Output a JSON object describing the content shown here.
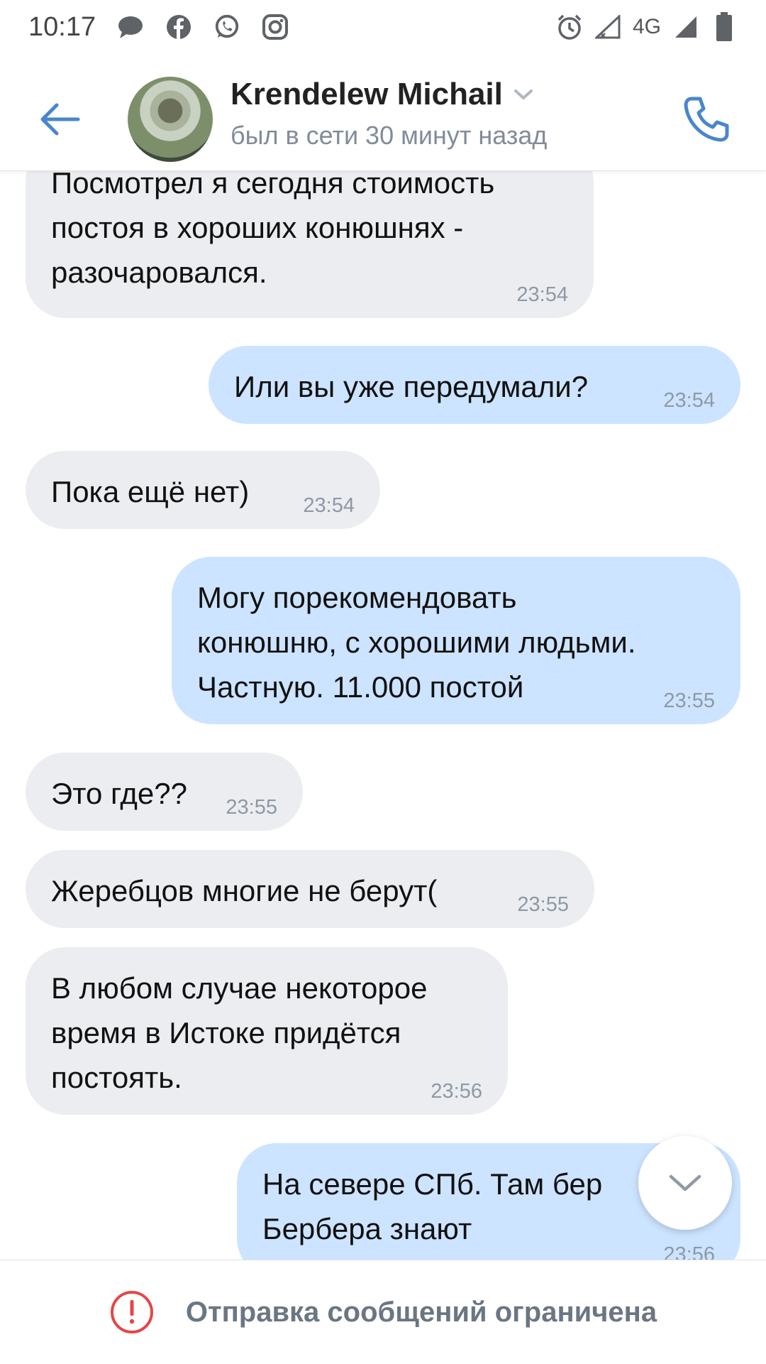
{
  "status_bar": {
    "time": "10:17",
    "network_label": "4G",
    "notification_icons": [
      "message-bubble-icon",
      "facebook-icon",
      "whatsapp-icon",
      "instagram-icon"
    ]
  },
  "header": {
    "contact_name": "Krendelew Michail",
    "contact_status": "был в сети 30 минут назад",
    "accent_color": "#4986cc"
  },
  "messages": [
    {
      "direction": "in",
      "text": "Посмотрел я сегодня стоимость\nпостоя в хороших конюшнях -\nразочаровался.",
      "time": "23:54"
    },
    {
      "direction": "out",
      "text": "Или вы уже передумали?",
      "time": "23:54"
    },
    {
      "direction": "in",
      "text": "Пока ещё нет)",
      "time": "23:54"
    },
    {
      "direction": "out",
      "text": "Могу порекомендовать\nконюшню, с хорошими людьми.\nЧастную. 11.000 постой",
      "time": "23:55"
    },
    {
      "direction": "in",
      "text": "Это где??",
      "time": "23:55"
    },
    {
      "direction": "in",
      "text": "Жеребцов многие не берут(",
      "time": "23:55"
    },
    {
      "direction": "in",
      "text": "В любом случае некоторое\nвремя в Истоке придётся\nпостоять.",
      "time": "23:56"
    },
    {
      "direction": "out",
      "text": "На севере СПб. Там бер\nБербера знают",
      "time": "23:56"
    }
  ],
  "bottom_bar": {
    "restriction_text": "Отправка сообщений ограничена",
    "alert_color": "#e64646"
  },
  "colors": {
    "incoming_bubble": "#ebedf0",
    "outgoing_bubble": "#cce4ff"
  }
}
